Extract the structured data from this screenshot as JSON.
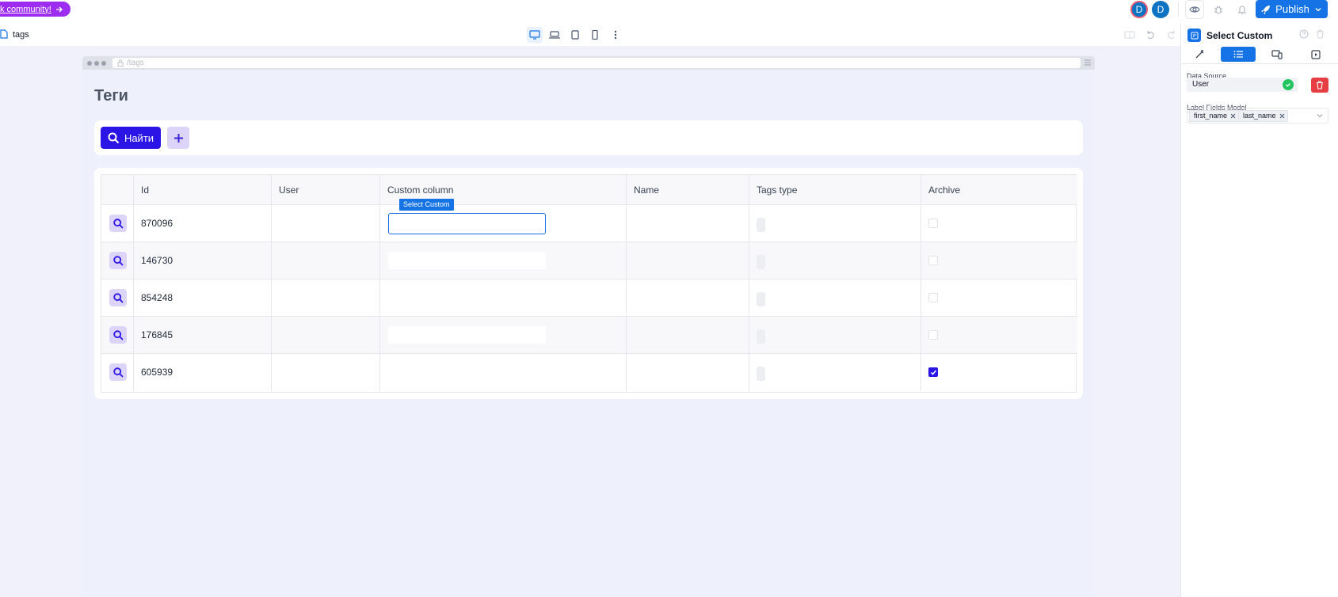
{
  "topbar": {
    "community_link": "k community!",
    "avatars": [
      "D",
      "D"
    ],
    "publish_label": "Publish"
  },
  "secondary": {
    "page_name": "tags"
  },
  "browser": {
    "url": "/tags"
  },
  "page": {
    "title": "Теги",
    "search_button": "Найти"
  },
  "table": {
    "columns": [
      "Id",
      "User",
      "Custom column",
      "Name",
      "Tags type",
      "Archive"
    ],
    "rows": [
      {
        "id": "870096",
        "archive": false
      },
      {
        "id": "146730",
        "archive": false
      },
      {
        "id": "854248",
        "archive": false
      },
      {
        "id": "176845",
        "archive": false
      },
      {
        "id": "605939",
        "archive": true
      }
    ],
    "selected_component_tag": "Select Custom"
  },
  "panel": {
    "title": "Select Custom",
    "data_source_label": "Data Source",
    "data_source_value": "User",
    "label_fields_label": "Label Fields Model",
    "label_fields": [
      "first_name",
      "last_name"
    ]
  },
  "colors": {
    "primary": "#2b14e6",
    "publish": "#1673e6",
    "community": "#9b2cf0",
    "danger": "#e53e45",
    "success": "#22c55e"
  }
}
